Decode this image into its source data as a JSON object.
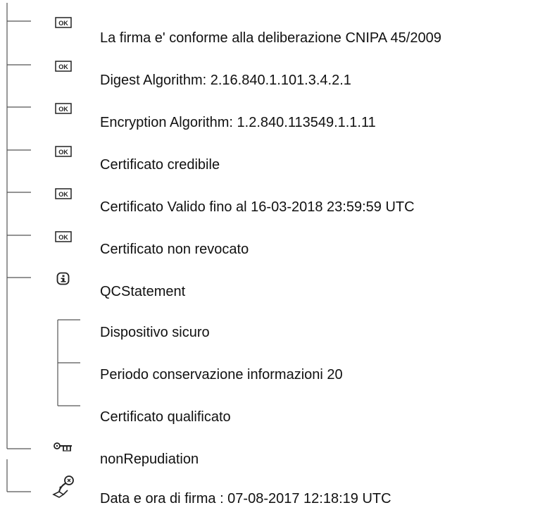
{
  "tree": {
    "items": [
      {
        "label": "La firma e' conforme alla deliberazione CNIPA 45/2009",
        "icon": "ok-icon"
      },
      {
        "label": "Digest Algorithm: 2.16.840.1.101.3.4.2.1",
        "icon": "ok-icon"
      },
      {
        "label": "Encryption Algorithm: 1.2.840.113549.1.1.11",
        "icon": "ok-icon"
      },
      {
        "label": "Certificato credibile",
        "icon": "ok-icon"
      },
      {
        "label": "Certificato Valido fino al 16-03-2018 23:59:59 UTC",
        "icon": "ok-icon"
      },
      {
        "label": "Certificato non revocato",
        "icon": "ok-icon"
      },
      {
        "label": "QCStatement",
        "icon": "info-icon",
        "children": [
          {
            "label": "Dispositivo sicuro"
          },
          {
            "label": "Periodo conservazione informazioni 20"
          },
          {
            "label": "Certificato qualificato"
          }
        ]
      },
      {
        "label": "nonRepudiation",
        "icon": "key-icon"
      }
    ],
    "footer_item": {
      "label": "Data e ora di firma : 07-08-2017 12:18:19 UTC",
      "icon": "seal-icon"
    }
  },
  "colors": {
    "line": "#555555",
    "text": "#111111",
    "icon": "#222222"
  }
}
